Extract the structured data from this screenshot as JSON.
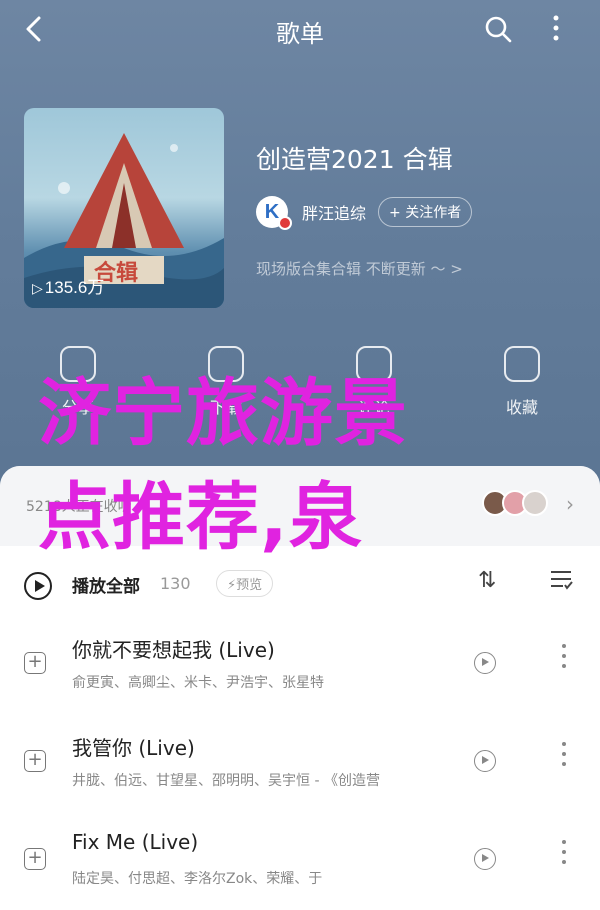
{
  "header": {
    "title": "歌单"
  },
  "album": {
    "title": "创造营2021 合辑",
    "play_count": "135.6万",
    "cover_text": "合辑",
    "creator_name": "胖汪追综",
    "follow_label": "+ 关注作者",
    "description": "现场版合集合辑 不断更新 ～ >"
  },
  "actions": [
    {
      "label": "分享",
      "icon": "share-icon"
    },
    {
      "label": "下载",
      "icon": "download-icon"
    },
    {
      "label": "评论",
      "icon": "comment-icon"
    },
    {
      "label": "收藏",
      "icon": "favorite-icon"
    }
  ],
  "fans": {
    "info": "5218人正在收听"
  },
  "playall": {
    "label": "播放全部",
    "count": "130",
    "preview_label": "⚡预览"
  },
  "songs": [
    {
      "title": "你就不要想起我 (Live)",
      "artists": "俞更寅、高卿尘、米卡、尹浩宇、张星特"
    },
    {
      "title": "我管你 (Live)",
      "artists": "井胧、伯远、甘望星、邵明明、吴宇恒 - 《创造营"
    },
    {
      "title": "Fix Me (Live)",
      "artists": "陆定昊、付思超、李洛尔Zok、荣耀、于"
    }
  ],
  "overlay": {
    "line1": "济宁旅游景",
    "line2": "点推荐,泉"
  },
  "colors": {
    "header_bg": "#637d9b",
    "overlay_text": "#e023e0"
  }
}
